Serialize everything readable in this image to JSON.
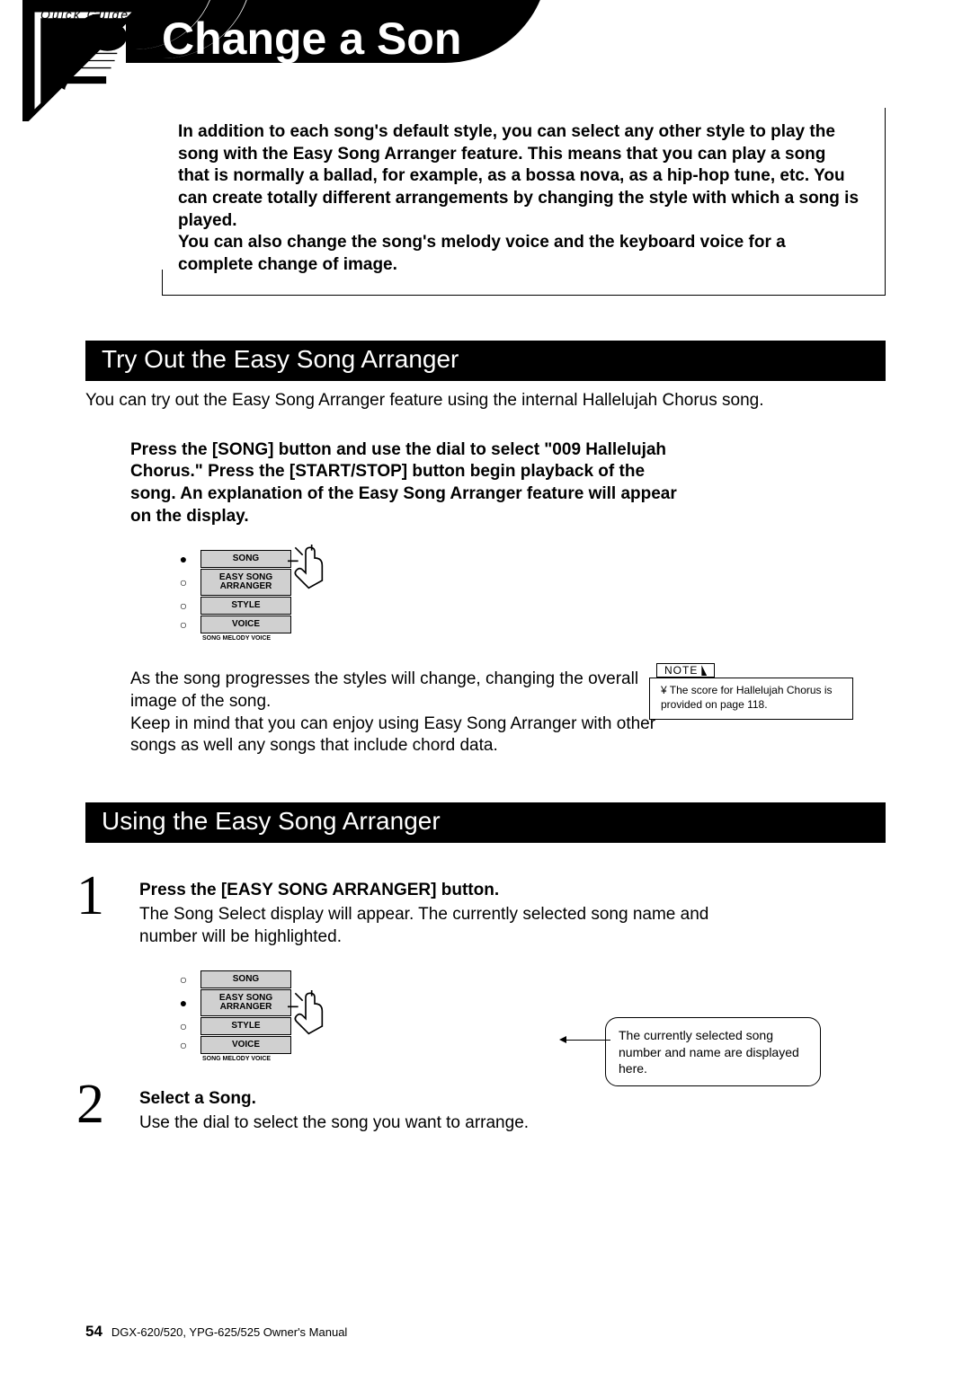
{
  "header": {
    "badge_text": "Quick Guide",
    "title": "Change a Son"
  },
  "intro": {
    "text": "In addition to each song's default style, you can select any other style to play the song with the Easy Song Arranger feature. This means that you can play a song that is normally a ballad, for example, as a bossa nova, as a hip-hop tune, etc. You can create totally different arrangements by changing the style with which a song is played.\nYou can also change the song's melody voice and the keyboard voice for a complete change of image."
  },
  "section1": {
    "title": "Try Out the Easy Song Arranger",
    "lead": "You can try out the Easy Song Arranger feature using the internal Hallelujah Chorus song.",
    "instructions": "Press the [SONG] button and use the dial to select \"009 Hallelujah Chorus.\" Press the [START/STOP] button begin playback of the song. An explanation of the Easy Song Arranger feature will appear on the display.",
    "followup": "As the song progresses the styles will change, changing the overall image of the song.\nKeep in mind that you can enjoy using Easy Song Arranger with other songs as well any songs that include chord data."
  },
  "panelA": {
    "buttons": [
      "SONG",
      "EASY SONG\nARRANGER",
      "STYLE",
      "VOICE"
    ],
    "selected_index": 0,
    "subtext": "SONG MELODY VOICE"
  },
  "note": {
    "label": "NOTE",
    "body": "¥ The score for Hallelujah Chorus is provided on page 118."
  },
  "section2": {
    "title": "Using the Easy Song Arranger",
    "steps": [
      {
        "num": "1",
        "heading": "Press the [EASY SONG ARRANGER] button.",
        "body": "The Song Select display will appear. The currently selected song name and number will be highlighted."
      },
      {
        "num": "2",
        "heading": "Select a Song.",
        "body": "Use the dial to select the song you want to arrange."
      }
    ],
    "callout": "The currently selected song number and name are displayed here."
  },
  "panelB": {
    "buttons": [
      "SONG",
      "EASY SONG\nARRANGER",
      "STYLE",
      "VOICE"
    ],
    "selected_index": 1,
    "subtext": "SONG MELODY VOICE"
  },
  "footer": {
    "page": "54",
    "text": "DGX-620/520, YPG-625/525  Owner's Manual"
  }
}
